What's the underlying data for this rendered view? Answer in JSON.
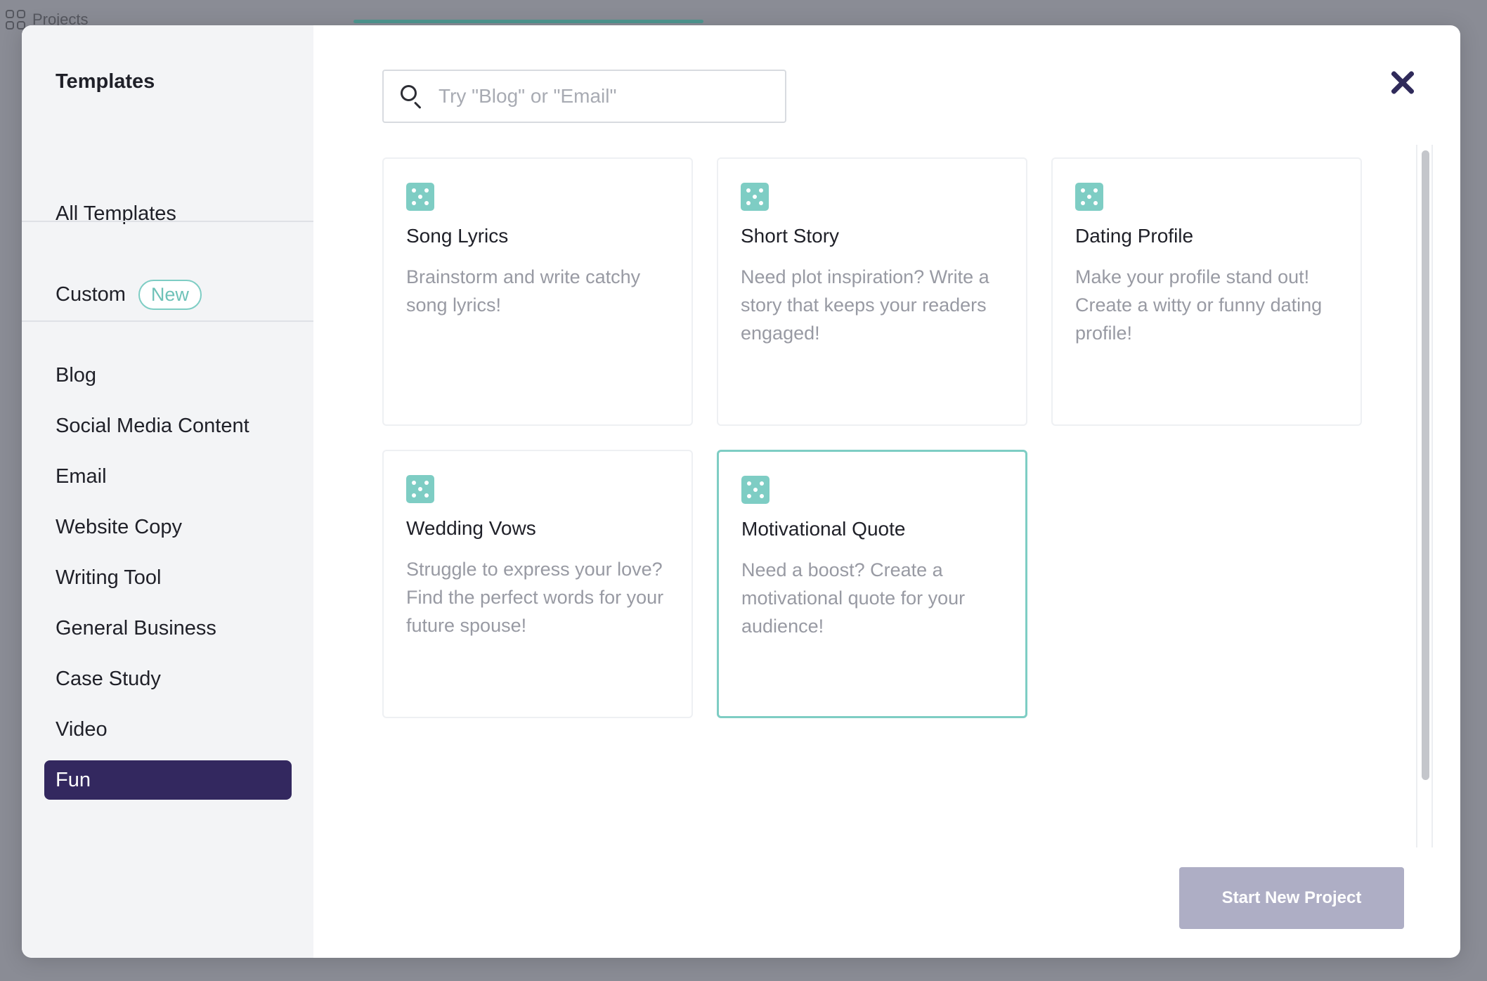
{
  "background": {
    "projects_label": "Projects"
  },
  "sidebar": {
    "title": "Templates",
    "all_templates": "All Templates",
    "custom": {
      "label": "Custom",
      "badge": "New"
    },
    "categories": [
      {
        "label": "Blog",
        "active": false
      },
      {
        "label": "Social Media Content",
        "active": false
      },
      {
        "label": "Email",
        "active": false
      },
      {
        "label": "Website Copy",
        "active": false
      },
      {
        "label": "Writing Tool",
        "active": false
      },
      {
        "label": "General Business",
        "active": false
      },
      {
        "label": "Case Study",
        "active": false
      },
      {
        "label": "Video",
        "active": false
      },
      {
        "label": "Fun",
        "active": true
      }
    ]
  },
  "search": {
    "placeholder": "Try \"Blog\" or \"Email\"",
    "value": "",
    "icon": "search-icon"
  },
  "close": {
    "icon": "close-icon"
  },
  "cards": [
    {
      "title": "Song Lyrics",
      "description": "Brainstorm and write catchy song lyrics!",
      "icon": "dice-icon",
      "selected": false
    },
    {
      "title": "Short Story",
      "description": "Need plot inspiration? Write a story that keeps your readers engaged!",
      "icon": "dice-icon",
      "selected": false
    },
    {
      "title": "Dating Profile",
      "description": "Make your profile stand out! Create a witty or funny dating profile!",
      "icon": "dice-icon",
      "selected": false
    },
    {
      "title": "Wedding Vows",
      "description": "Struggle to express your love? Find the perfect words for your future spouse!",
      "icon": "dice-icon",
      "selected": false
    },
    {
      "title": "Motivational Quote",
      "description": "Need a boost? Create a motivational quote for your audience!",
      "icon": "dice-icon",
      "selected": true
    }
  ],
  "footer": {
    "start_button": "Start New Project"
  },
  "colors": {
    "accent_teal": "#7ecdc4",
    "active_nav": "#33285f",
    "button_disabled": "#aeaec5"
  }
}
